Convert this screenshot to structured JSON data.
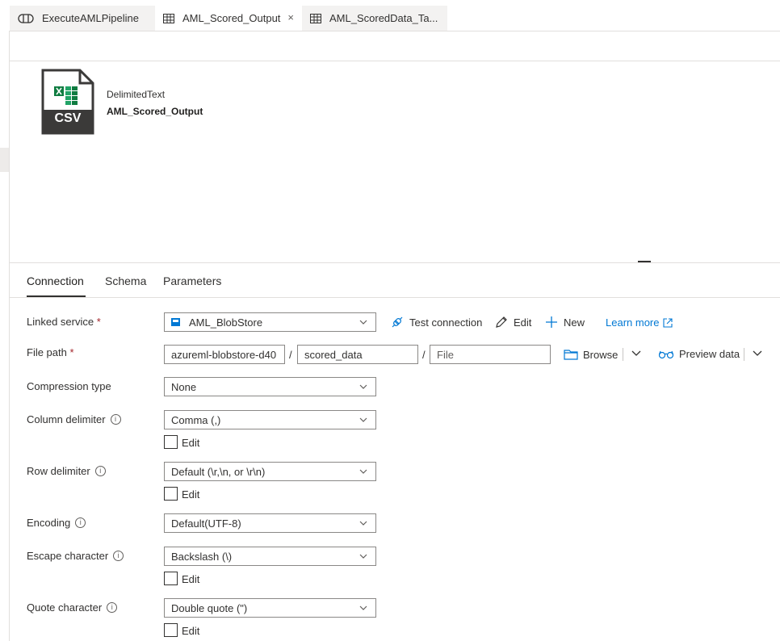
{
  "tabs": [
    {
      "label": "ExecuteAMLPipeline",
      "icon": "pipeline-icon"
    },
    {
      "label": "AML_Scored_Output",
      "icon": "table-icon",
      "close": "×"
    },
    {
      "label": "AML_ScoredData_Ta...",
      "icon": "table-icon"
    }
  ],
  "dataset": {
    "icon_label": "CSV",
    "type": "DelimitedText",
    "name": "AML_Scored_Output"
  },
  "subtabs": [
    "Connection",
    "Schema",
    "Parameters"
  ],
  "form": {
    "linked_service": {
      "label": "Linked service",
      "value": "AML_BlobStore"
    },
    "actions": {
      "test_connection": "Test connection",
      "edit": "Edit",
      "new": "New",
      "learn_more": "Learn more"
    },
    "file_path": {
      "label": "File path",
      "container": "azureml-blobstore-d40",
      "directory": "scored_data",
      "file_placeholder": "File",
      "separator": "/",
      "browse": "Browse",
      "preview": "Preview data"
    },
    "compression": {
      "label": "Compression type",
      "value": "None"
    },
    "column_delimiter": {
      "label": "Column delimiter",
      "value": "Comma (,)",
      "edit": "Edit"
    },
    "row_delimiter": {
      "label": "Row delimiter",
      "value": "Default (\\r,\\n, or \\r\\n)",
      "edit": "Edit"
    },
    "encoding": {
      "label": "Encoding",
      "value": "Default(UTF-8)"
    },
    "escape_character": {
      "label": "Escape character",
      "value": "Backslash (\\)",
      "edit": "Edit"
    },
    "quote_character": {
      "label": "Quote character",
      "value": "Double quote (\")",
      "edit": "Edit"
    },
    "required_mark": "*"
  },
  "colors": {
    "accent": "#0078d4",
    "excel_green": "#21a366",
    "icon_dark": "#3b3a39"
  }
}
